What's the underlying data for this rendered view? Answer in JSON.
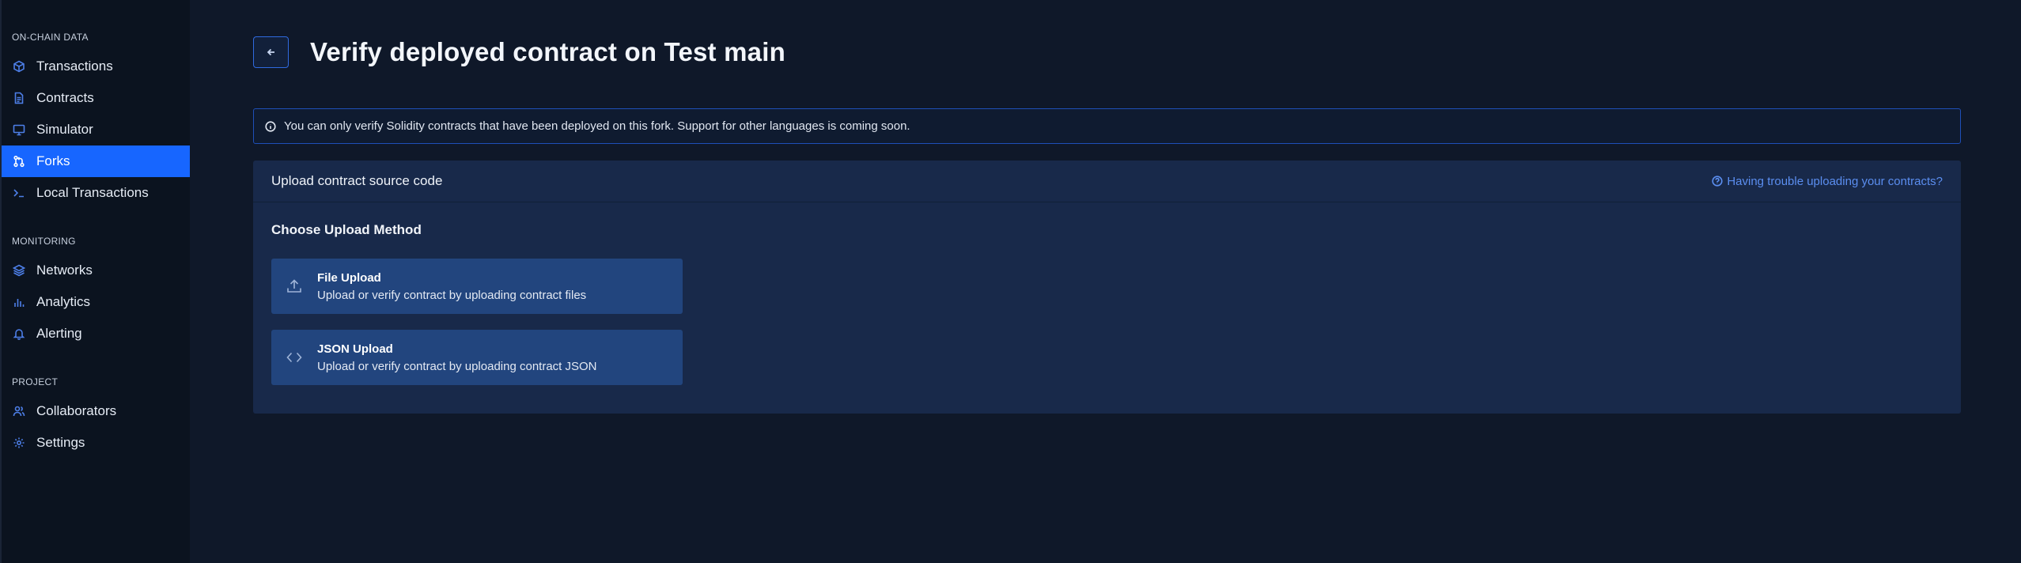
{
  "sidebar": {
    "sections": [
      {
        "label": "ON-CHAIN DATA",
        "items": [
          {
            "label": "Transactions",
            "icon": "cube-icon"
          },
          {
            "label": "Contracts",
            "icon": "document-icon"
          },
          {
            "label": "Simulator",
            "icon": "monitor-icon"
          },
          {
            "label": "Forks",
            "icon": "fork-icon",
            "active": true
          },
          {
            "label": "Local Transactions",
            "icon": "terminal-icon"
          }
        ]
      },
      {
        "label": "MONITORING",
        "items": [
          {
            "label": "Networks",
            "icon": "layers-icon"
          },
          {
            "label": "Analytics",
            "icon": "bar-chart-icon"
          },
          {
            "label": "Alerting",
            "icon": "bell-icon"
          }
        ]
      },
      {
        "label": "PROJECT",
        "items": [
          {
            "label": "Collaborators",
            "icon": "users-icon"
          },
          {
            "label": "Settings",
            "icon": "gear-icon"
          }
        ]
      }
    ]
  },
  "header": {
    "title": "Verify deployed contract on Test main"
  },
  "banner": {
    "text": "You can only verify Solidity contracts that have been deployed on this fork. Support for other languages is coming soon."
  },
  "card": {
    "title": "Upload contract source code",
    "help_link": "Having trouble uploading your contracts?",
    "method_title": "Choose Upload Method",
    "options": [
      {
        "title": "File Upload",
        "description": "Upload or verify contract by uploading contract files",
        "icon": "upload-icon"
      },
      {
        "title": "JSON Upload",
        "description": "Upload or verify contract by uploading contract JSON",
        "icon": "code-icon"
      }
    ]
  },
  "colors": {
    "accent": "#1766ff",
    "background": "#0f1829",
    "sidebar": "#0b131f",
    "card": "#18294a",
    "option": "#22457e"
  }
}
